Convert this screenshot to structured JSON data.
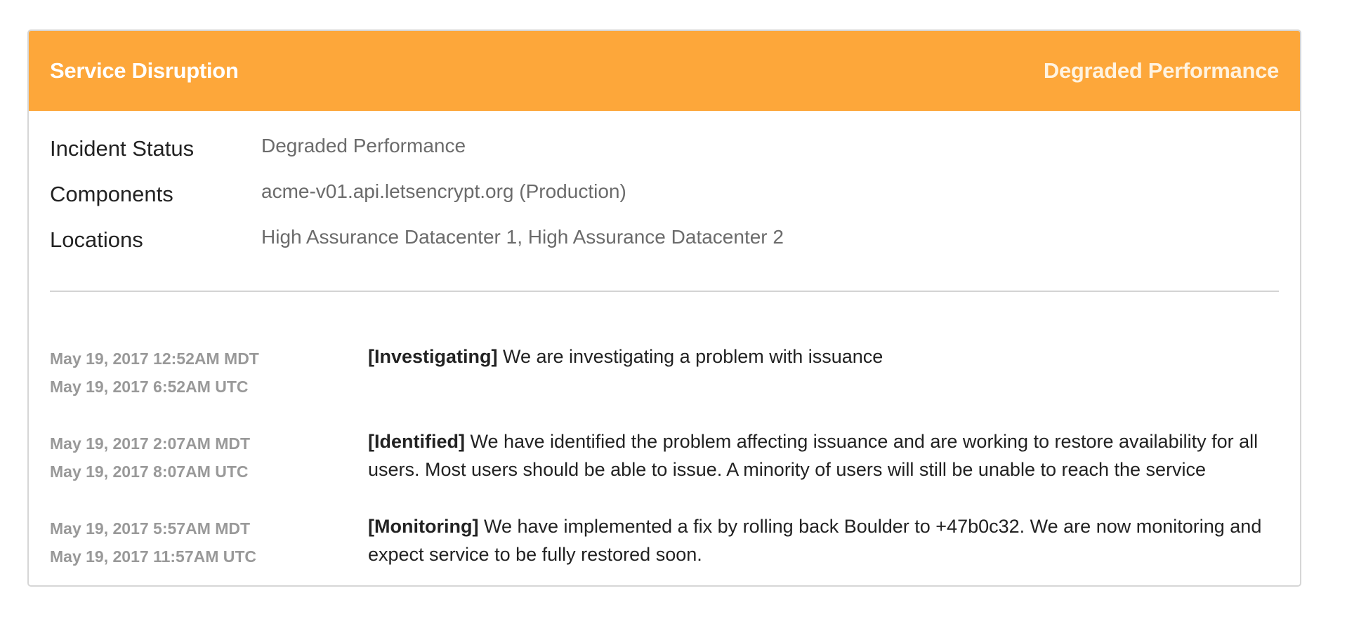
{
  "header": {
    "title": "Service Disruption",
    "status": "Degraded Performance",
    "color": "#fda73a"
  },
  "meta": [
    {
      "label": "Incident Status",
      "value": "Degraded Performance"
    },
    {
      "label": "Components",
      "value": "acme-v01.api.letsencrypt.org (Production)"
    },
    {
      "label": "Locations",
      "value": "High Assurance Datacenter 1, High Assurance Datacenter 2"
    }
  ],
  "updates": [
    {
      "time_local": "May 19, 2017 12:52AM MDT",
      "time_utc": "May 19, 2017 6:52AM UTC",
      "status": "[Investigating]",
      "message": " We are investigating a problem with issuance"
    },
    {
      "time_local": "May 19, 2017 2:07AM MDT",
      "time_utc": "May 19, 2017 8:07AM UTC",
      "status": "[Identified]",
      "message": " We have identified the problem affecting issuance and are working to restore availability for all users. Most users should be able to issue. A minority of users will still be unable to reach the service"
    },
    {
      "time_local": "May 19, 2017 5:57AM MDT",
      "time_utc": "May 19, 2017 11:57AM UTC",
      "status": "[Monitoring]",
      "message": " We have implemented a fix by rolling back Boulder to +47b0c32. We are now monitoring and expect service to be fully restored soon."
    }
  ]
}
